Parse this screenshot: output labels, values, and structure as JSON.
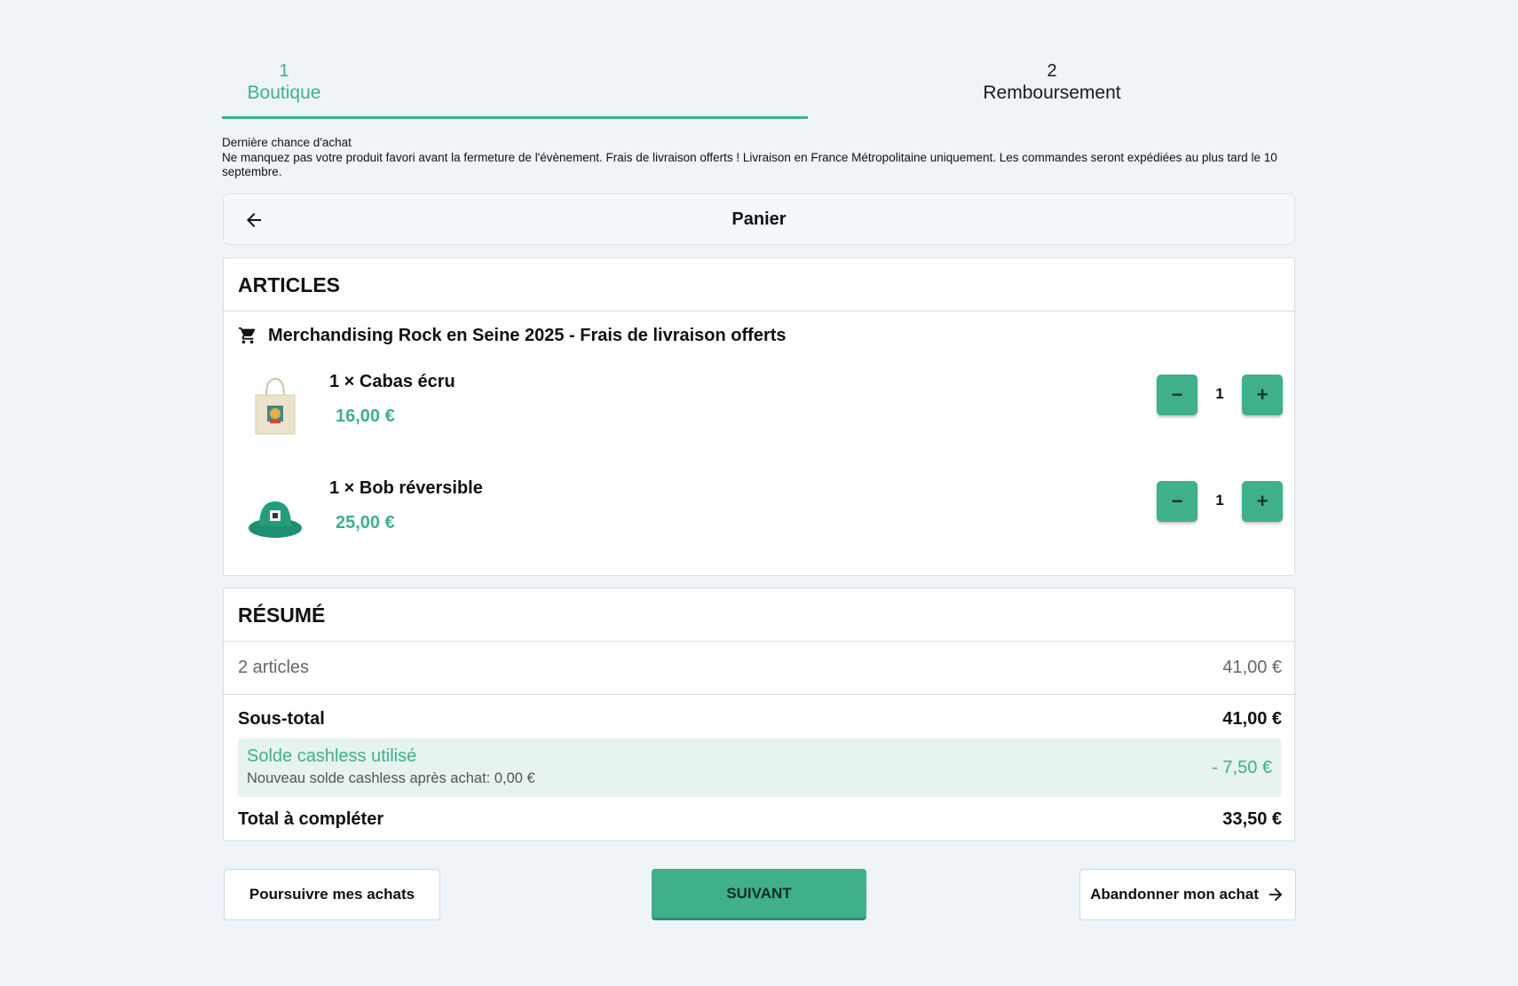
{
  "stepper": {
    "step1": {
      "number": "1",
      "label": "Boutique"
    },
    "step2": {
      "number": "2",
      "label": "Remboursement"
    }
  },
  "info": {
    "title": "Dernière chance d'achat",
    "text": "Ne manquez pas votre produit favori avant la fermeture de l'évènement. Frais de livraison offerts ! Livraison en France Métropolitaine uniquement. Les commandes seront expédiées au plus tard le 10 septembre."
  },
  "cart": {
    "title": "Panier"
  },
  "articles": {
    "title": "ARTICLES",
    "group_label": "Merchandising Rock en Seine 2025 - Frais de livraison offerts",
    "items": [
      {
        "name": "1 × Cabas écru",
        "price": "16,00 €",
        "qty": "1",
        "minus": "−",
        "plus": "+"
      },
      {
        "name": "1 × Bob réversible",
        "price": "25,00 €",
        "qty": "1",
        "minus": "−",
        "plus": "+"
      }
    ]
  },
  "summary": {
    "title": "RÉSUMÉ",
    "articles_label": "2 articles",
    "articles_amount": "41,00 €",
    "subtotal_label": "Sous-total",
    "subtotal_amount": "41,00 €",
    "cashless_title": "Solde cashless utilisé",
    "cashless_sub": "Nouveau solde cashless après achat: 0,00 €",
    "cashless_amount": "- 7,50 €",
    "total_label": "Total à compléter",
    "total_amount": "33,50 €"
  },
  "buttons": {
    "continue": "Poursuivre mes achats",
    "next": "SUIVANT",
    "abandon": "Abandonner mon achat"
  },
  "colors": {
    "accent": "#3fb08a",
    "background": "#eff4f8"
  },
  "icons": {
    "back": "arrow-left-icon",
    "cart": "cart-icon",
    "abandon": "arrow-right-icon"
  }
}
